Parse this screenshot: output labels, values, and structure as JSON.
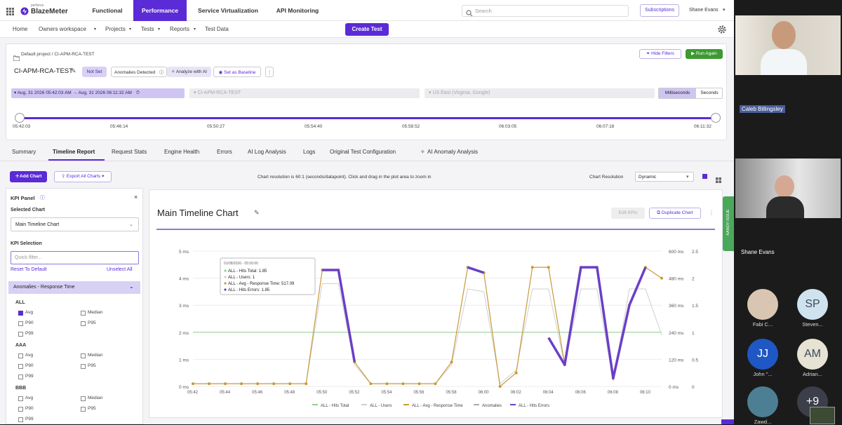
{
  "brand": {
    "prefix": "perforce",
    "name": "BlazeMeter"
  },
  "nav": {
    "tabs": [
      "Functional",
      "Performance",
      "Service Virtualization",
      "API Monitoring"
    ],
    "search_placeholder": "Search",
    "subscriptions": "Subscriptions",
    "user": "Shane Evans"
  },
  "subnav": {
    "items": [
      "Home",
      "Owners workspace",
      "Projects",
      "Tests",
      "Reports",
      "Test Data"
    ],
    "create_test": "Create Test"
  },
  "test": {
    "breadcrumb": "Default project / CI-APM-RCA-TEST",
    "title": "CI-APM-RCA-TEST",
    "not_set": "Not Set",
    "anomalies": "Anomalies Detected",
    "analyze": "Analyze with AI",
    "baseline": "Set as Baseline",
    "hide_filters": "Hide Filters",
    "run_again": "Run Again",
    "date_range": "Aug, 31 2026 05:42:03 AM → Aug, 31 2026 06:11:32 AM",
    "scenario": "CI-APM-RCA-TEST",
    "location": "US East (Virginia, Google)",
    "unit_ms": "Milliseconds",
    "unit_s": "Seconds",
    "ticks": [
      "05:42:03",
      "05:46:14",
      "05:50:27",
      "05:54:40",
      "05:58:52",
      "06:03:05",
      "06:07:18",
      "06:11:32"
    ]
  },
  "report_tabs": [
    "Summary",
    "Timeline Report",
    "Request Stats",
    "Engine Health",
    "Errors",
    "AI Log Analysis",
    "Logs",
    "Original Test Configuration",
    "AI Anomaly Analysis"
  ],
  "toolbar": {
    "add_chart": "Add Chart",
    "export": "Export All Charts",
    "resolution_note": "Chart resolution is 60:1 (seconds/datapoint). Click and drag in the plot area to zoom in",
    "resolution_label": "Chart Resolution",
    "resolution_value": "Dynamic"
  },
  "kpi": {
    "title": "KPI Panel",
    "selected_chart_label": "Selected Chart",
    "selected_chart": "Main Timeline Chart",
    "selection_label": "KPI Selection",
    "filter_placeholder": "Quick filter...",
    "reset": "Reset To Default",
    "unselect": "Unselect All",
    "section": "Anomalies - Response Time",
    "groups": [
      {
        "name": "ALL",
        "options": [
          [
            "Avg",
            "Median"
          ],
          [
            "P90",
            "P95"
          ],
          [
            "P99",
            ""
          ]
        ]
      },
      {
        "name": "AAA",
        "options": [
          [
            "Avg",
            "Median"
          ],
          [
            "P90",
            "P95"
          ],
          [
            "P99",
            ""
          ]
        ]
      },
      {
        "name": "BBB",
        "options": [
          [
            "Avg",
            "Median"
          ],
          [
            "P90",
            "P95"
          ],
          [
            "P99",
            ""
          ]
        ]
      }
    ]
  },
  "chart_card": {
    "title": "Main Timeline Chart",
    "edit_kpis": "Edit KPIs",
    "duplicate": "Duplicate Chart",
    "side_tab": "KANOY ISSUE",
    "tooltip": {
      "time": "01/08/2026 - 05:50:00",
      "lines": [
        "ALL - Hits Total: 1.85",
        "ALL - Users: 1",
        "ALL - Avg - Response Time: 517.09",
        "ALL - Hits Errors: 1.85"
      ]
    }
  },
  "chart_data": {
    "type": "line",
    "x": [
      "05:42",
      "05:43",
      "05:44",
      "05:45",
      "05:46",
      "05:47",
      "05:48",
      "05:49",
      "05:50",
      "05:51",
      "05:52",
      "05:53",
      "05:54",
      "05:55",
      "05:56",
      "05:57",
      "05:58",
      "05:59",
      "06:00",
      "06:01",
      "06:02",
      "06:03",
      "06:04",
      "06:05",
      "06:06",
      "06:07",
      "06:08",
      "06:09",
      "06:10",
      "06:11"
    ],
    "x_ticks": [
      "05:42",
      "05:44",
      "05:46",
      "05:48",
      "05:50",
      "05:52",
      "05:54",
      "05:56",
      "05:58",
      "06:00",
      "06:02",
      "06:04",
      "06:06",
      "06:08",
      "06:10"
    ],
    "y_left_ticks": [
      "0 ms",
      "1 ms",
      "2 ms",
      "3 ms",
      "4 ms",
      "5 ms"
    ],
    "y_mid_ticks": [
      "0 ms",
      "120 ms",
      "240 ms",
      "360 ms",
      "480 ms",
      "600 ms"
    ],
    "y_right_ticks": [
      "0",
      "0.5",
      "1",
      "1.5",
      "2",
      "2.5"
    ],
    "ylim_left": [
      0,
      5
    ],
    "series": [
      {
        "name": "ALL - Hits Total",
        "color": "#8fd18f",
        "values": [
          2,
          2,
          2,
          2,
          2,
          2,
          2,
          2,
          2,
          2,
          2,
          2,
          2,
          2,
          2,
          2,
          2,
          2,
          2,
          2,
          2,
          2,
          2,
          2,
          2,
          2,
          2,
          2,
          2,
          2
        ]
      },
      {
        "name": "ALL - Users",
        "color": "#cfcfcf",
        "values": [
          0.1,
          0.1,
          0.1,
          0.1,
          0.1,
          0.1,
          0.1,
          0.1,
          3.8,
          3.8,
          0.8,
          0.1,
          0.1,
          0.1,
          0.1,
          0.1,
          0.8,
          3.6,
          3.5,
          0.1,
          0.6,
          3.6,
          3.6,
          0.8,
          3.6,
          3.6,
          0.2,
          3.6,
          3.6,
          1.9
        ]
      },
      {
        "name": "ALL - Avg - Response Time",
        "color": "#c89a3a",
        "values": [
          0.1,
          0.1,
          0.1,
          0.1,
          0.1,
          0.1,
          0.1,
          0.1,
          4.3,
          4.3,
          0.9,
          0.1,
          0.1,
          0.1,
          0.1,
          0.1,
          0.9,
          4.4,
          4.2,
          0.0,
          0.5,
          4.4,
          4.4,
          0.8,
          4.4,
          4.4,
          0.3,
          3.0,
          4.4,
          4.0
        ]
      },
      {
        "name": "Anomalies",
        "color": "#aaaaaa",
        "values": [
          null,
          null,
          null,
          null,
          null,
          null,
          null,
          null,
          null,
          null,
          null,
          null,
          null,
          null,
          null,
          null,
          null,
          null,
          null,
          null,
          null,
          null,
          null,
          null,
          null,
          null,
          null,
          null,
          null,
          null
        ]
      },
      {
        "name": "ALL - Hits Errors",
        "color": "#6a3fc7",
        "values": [
          null,
          null,
          null,
          null,
          null,
          null,
          null,
          null,
          4.3,
          4.3,
          0.9,
          null,
          null,
          null,
          null,
          null,
          null,
          4.4,
          4.2,
          null,
          null,
          null,
          1.8,
          0.8,
          4.4,
          4.4,
          0.3,
          3.0,
          4.4,
          null
        ]
      }
    ]
  },
  "video": {
    "participants": [
      "Caleb Billingsley",
      "Shane Evans"
    ],
    "avatars": [
      {
        "initials": "",
        "name": "Fabi C...",
        "color": "#d9c6b2"
      },
      {
        "initials": "SP",
        "name": "Steven...",
        "color": "#cfe3ef"
      },
      {
        "initials": "JJ",
        "name": "John \"...",
        "color": "#1f57c4"
      },
      {
        "initials": "AM",
        "name": "Adrian...",
        "color": "#e6e2d4"
      },
      {
        "initials": "",
        "name": "Zawd...",
        "color": "#4d7f94"
      },
      {
        "initials": "+9",
        "name": "",
        "color": "#3c3f4a"
      }
    ]
  }
}
